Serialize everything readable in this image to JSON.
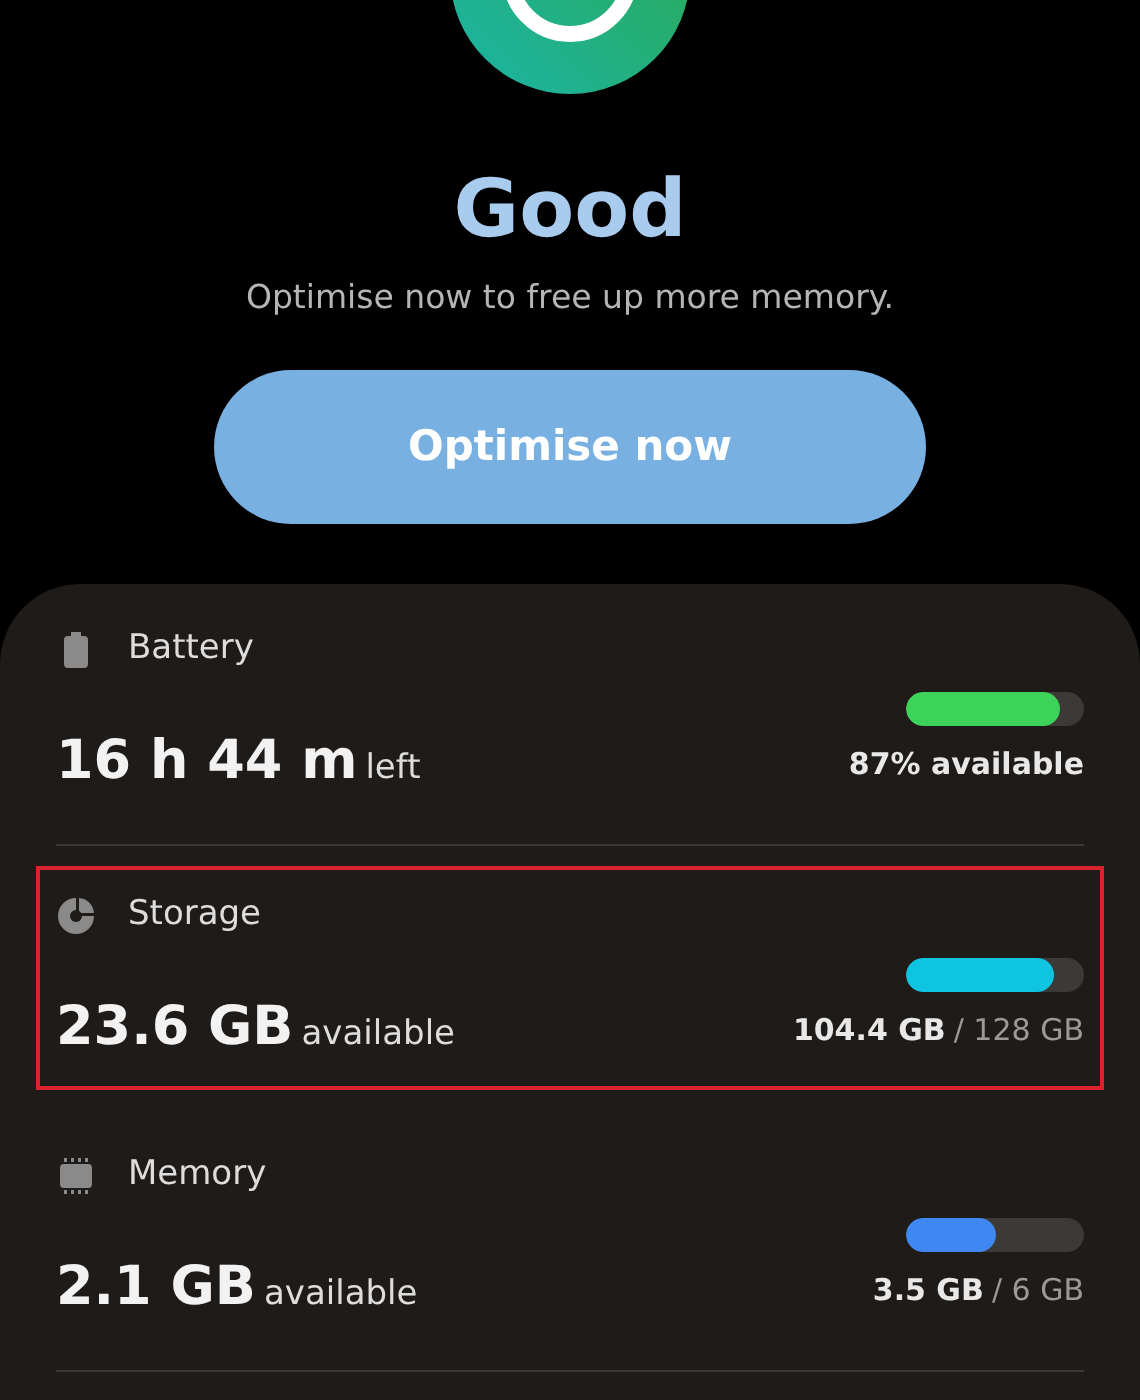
{
  "status": {
    "title": "Good",
    "message": "Optimise now to free up more memory."
  },
  "button": {
    "label": "Optimise now"
  },
  "items": [
    {
      "kind": "battery",
      "name": "Battery",
      "value": "16 h 44 m",
      "unit": "left",
      "level": 0.87,
      "color": "#3dd35a",
      "reading": "87% available",
      "highlighted": false
    },
    {
      "kind": "storage",
      "name": "Storage",
      "value": "23.6 GB",
      "unit": "available",
      "level": 0.83,
      "color": "#0ec4e0",
      "reading": "104.4 GB",
      "reading_total": "/ 128 GB",
      "highlighted": true
    },
    {
      "kind": "memory",
      "name": "Memory",
      "value": "2.1 GB",
      "unit": "available",
      "level": 0.5,
      "color": "#3f87f3",
      "reading": "3.5 GB",
      "reading_total": "/ 6 GB",
      "highlighted": false
    }
  ]
}
